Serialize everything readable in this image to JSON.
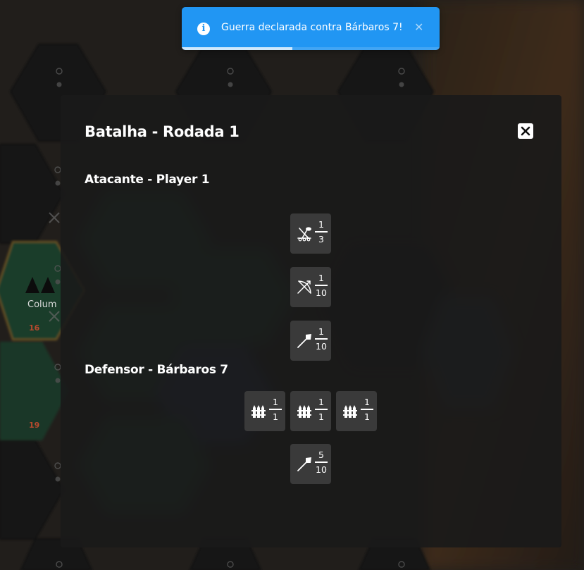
{
  "toast": {
    "message": "Guerra declarada contra Bárbaros 7!",
    "close_symbol": "✕",
    "icon": "info-icon",
    "color": "#2196f3",
    "progress": 0.43
  },
  "background": {
    "tile_label": "Colum",
    "tile_numbers": [
      "16",
      "19"
    ]
  },
  "modal": {
    "title": "Batalha - Rodada 1",
    "close_icon": "close-icon",
    "attacker": {
      "heading": "Atacante - Player 1",
      "units": [
        {
          "icon": "catapult-icon",
          "current": "1",
          "total": "3"
        },
        {
          "icon": "bow-icon",
          "current": "1",
          "total": "10"
        },
        {
          "icon": "spear-icon",
          "current": "1",
          "total": "10"
        }
      ]
    },
    "defender": {
      "heading": "Defensor - Bárbaros 7",
      "units": [
        {
          "icon": "palisade-icon",
          "current": "1",
          "total": "1"
        },
        {
          "icon": "palisade-icon",
          "current": "1",
          "total": "1"
        },
        {
          "icon": "palisade-icon",
          "current": "1",
          "total": "1"
        },
        {
          "icon": "spear-icon",
          "current": "5",
          "total": "10"
        }
      ]
    }
  }
}
